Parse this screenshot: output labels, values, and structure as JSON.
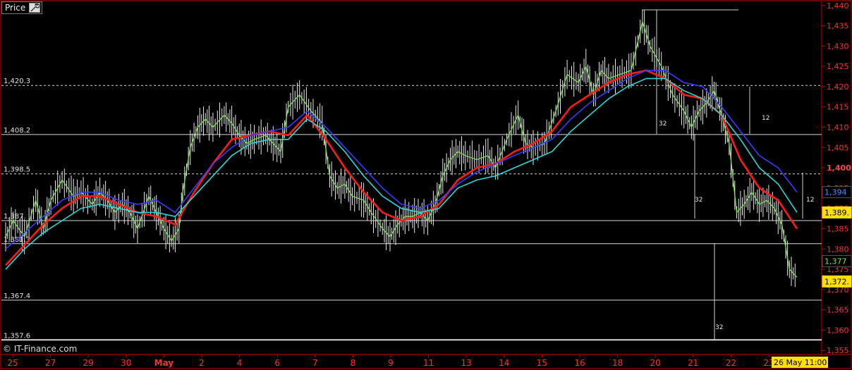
{
  "panel": {
    "tab_label": "Price",
    "tool_icon": "wrench-icon"
  },
  "credit": "© IT-Finance.com",
  "colors": {
    "background": "#000000",
    "frame": "#cc0000",
    "axis_text": "#ff2a2a",
    "ma_green": "#7ee05a",
    "ma_red": "#ff1a1a",
    "ma_blue": "#3a3aff",
    "ma_cyan": "#2bd6d6",
    "price": "#e8e8e8",
    "badge_yellow": "#ffe000"
  },
  "chart_data": {
    "type": "line",
    "title": "",
    "ylim": [
      1354,
      1441
    ],
    "y_ticks": [
      1440,
      1435,
      1430,
      1425,
      1420,
      1415,
      1410,
      1405,
      1400,
      1395,
      1390,
      1385,
      1380,
      1375,
      1370,
      1365,
      1360,
      1355
    ],
    "y_tick_labels": [
      "1,440",
      "1,435",
      "1,430",
      "1,425",
      "1,420",
      "1,415",
      "1,410",
      "1,405",
      "1,400",
      "1,395",
      "1,390",
      "1,385",
      "1,380",
      "1,375",
      "1,370",
      "1,365",
      "1,360",
      "1,355"
    ],
    "x_tick_labels": [
      "25",
      "27",
      "29",
      "30",
      "May",
      "2",
      "4",
      "6",
      "7",
      "8",
      "9",
      "11",
      "13",
      "14",
      "15",
      "16",
      "18",
      "20",
      "21",
      "22",
      "23"
    ],
    "x_tick_positions": [
      0,
      1,
      2,
      3,
      4,
      5,
      6,
      7,
      8,
      9,
      10,
      11,
      12,
      13,
      14,
      15,
      16,
      17,
      18,
      19,
      20
    ],
    "x_last_label": "26 May 11:00",
    "x_len": 21,
    "price": [
      [
        0,
        1383
      ],
      [
        0.2,
        1387
      ],
      [
        0.5,
        1383
      ],
      [
        0.8,
        1392
      ],
      [
        1,
        1385
      ],
      [
        1.2,
        1392
      ],
      [
        1.5,
        1397
      ],
      [
        1.8,
        1393
      ],
      [
        2,
        1394
      ],
      [
        2.3,
        1391
      ],
      [
        2.5,
        1394
      ],
      [
        2.7,
        1392
      ],
      [
        2.9,
        1389
      ],
      [
        3.1,
        1391
      ],
      [
        3.3,
        1389
      ],
      [
        3.5,
        1385
      ],
      [
        3.8,
        1393
      ],
      [
        4,
        1389
      ],
      [
        4.2,
        1385
      ],
      [
        4.4,
        1382
      ],
      [
        4.6,
        1385
      ],
      [
        4.7,
        1394
      ],
      [
        4.9,
        1405
      ],
      [
        5.1,
        1410
      ],
      [
        5.3,
        1412
      ],
      [
        5.5,
        1410
      ],
      [
        5.8,
        1413
      ],
      [
        6,
        1411
      ],
      [
        6.2,
        1408
      ],
      [
        6.4,
        1406
      ],
      [
        6.6,
        1407
      ],
      [
        6.9,
        1408
      ],
      [
        7.1,
        1406
      ],
      [
        7.3,
        1404
      ],
      [
        7.5,
        1415
      ],
      [
        7.8,
        1418
      ],
      [
        8.1,
        1414
      ],
      [
        8.4,
        1411
      ],
      [
        8.6,
        1398
      ],
      [
        8.8,
        1395
      ],
      [
        9.0,
        1396
      ],
      [
        9.2,
        1393
      ],
      [
        9.5,
        1392
      ],
      [
        9.7,
        1389
      ],
      [
        10,
        1385
      ],
      [
        10.2,
        1383
      ],
      [
        10.4,
        1386
      ],
      [
        10.6,
        1388
      ],
      [
        10.8,
        1388
      ],
      [
        11,
        1389
      ],
      [
        11.2,
        1387
      ],
      [
        11.4,
        1391
      ],
      [
        11.6,
        1398
      ],
      [
        11.8,
        1402
      ],
      [
        12,
        1404
      ],
      [
        12.2,
        1403
      ],
      [
        12.5,
        1402
      ],
      [
        12.8,
        1403
      ],
      [
        13,
        1400
      ],
      [
        13.3,
        1407
      ],
      [
        13.6,
        1413
      ],
      [
        13.8,
        1406
      ],
      [
        14.0,
        1405
      ],
      [
        14.3,
        1406
      ],
      [
        14.6,
        1414
      ],
      [
        14.9,
        1423
      ],
      [
        15.2,
        1421
      ],
      [
        15.4,
        1425
      ],
      [
        15.6,
        1418
      ],
      [
        15.8,
        1424
      ],
      [
        16.0,
        1422
      ],
      [
        16.3,
        1423
      ],
      [
        16.6,
        1424
      ],
      [
        16.9,
        1436
      ],
      [
        17.1,
        1430
      ],
      [
        17.4,
        1425
      ],
      [
        17.7,
        1418
      ],
      [
        18.0,
        1414
      ],
      [
        18.2,
        1410
      ],
      [
        18.4,
        1414
      ],
      [
        18.6,
        1416
      ],
      [
        18.8,
        1419
      ],
      [
        19.0,
        1413
      ],
      [
        19.2,
        1406
      ],
      [
        19.4,
        1389
      ],
      [
        19.6,
        1391
      ],
      [
        19.8,
        1394
      ],
      [
        20.0,
        1391
      ],
      [
        20.2,
        1392
      ],
      [
        20.4,
        1390
      ],
      [
        20.6,
        1386
      ],
      [
        20.8,
        1375
      ],
      [
        21.0,
        1373
      ]
    ],
    "series": [
      {
        "color": "#7ee05a",
        "values": [
          [
            0,
            1384
          ],
          [
            0.5,
            1385
          ],
          [
            1,
            1387
          ],
          [
            1.5,
            1393
          ],
          [
            2,
            1394
          ],
          [
            2.5,
            1393
          ],
          [
            3,
            1391
          ],
          [
            3.5,
            1388
          ],
          [
            4,
            1389
          ],
          [
            4.3,
            1385
          ],
          [
            4.6,
            1386
          ],
          [
            4.9,
            1400
          ],
          [
            5.2,
            1408
          ],
          [
            5.5,
            1410
          ],
          [
            6,
            1409
          ],
          [
            6.5,
            1407
          ],
          [
            7,
            1406
          ],
          [
            7.4,
            1410
          ],
          [
            7.8,
            1416
          ],
          [
            8.2,
            1413
          ],
          [
            8.6,
            1400
          ],
          [
            9,
            1395
          ],
          [
            9.5,
            1393
          ],
          [
            10,
            1388
          ],
          [
            10.4,
            1385
          ],
          [
            10.8,
            1388
          ],
          [
            11.2,
            1389
          ],
          [
            11.6,
            1397
          ],
          [
            12,
            1402
          ],
          [
            12.5,
            1402
          ],
          [
            13,
            1401
          ],
          [
            13.4,
            1407
          ],
          [
            13.8,
            1410
          ],
          [
            14.2,
            1406
          ],
          [
            14.6,
            1412
          ],
          [
            15,
            1420
          ],
          [
            15.5,
            1422
          ],
          [
            16,
            1423
          ],
          [
            16.5,
            1424
          ],
          [
            16.8,
            1427
          ],
          [
            17.1,
            1430
          ],
          [
            17.5,
            1424
          ],
          [
            18,
            1414
          ],
          [
            18.5,
            1415
          ],
          [
            18.9,
            1418
          ],
          [
            19.2,
            1410
          ],
          [
            19.4,
            1393
          ],
          [
            19.8,
            1393
          ],
          [
            20.2,
            1391
          ],
          [
            20.6,
            1386
          ],
          [
            20.9,
            1377
          ]
        ]
      },
      {
        "color": "#ff1a1a",
        "values": [
          [
            0,
            1376
          ],
          [
            0.5,
            1381
          ],
          [
            1,
            1386
          ],
          [
            1.5,
            1390
          ],
          [
            2,
            1393
          ],
          [
            2.5,
            1393
          ],
          [
            3,
            1391
          ],
          [
            3.5,
            1389
          ],
          [
            4,
            1388
          ],
          [
            4.5,
            1386
          ],
          [
            5,
            1394
          ],
          [
            5.5,
            1401
          ],
          [
            6,
            1407
          ],
          [
            6.5,
            1408
          ],
          [
            7,
            1409
          ],
          [
            7.5,
            1408
          ],
          [
            8,
            1413
          ],
          [
            8.5,
            1407
          ],
          [
            9,
            1400
          ],
          [
            9.5,
            1394
          ],
          [
            10,
            1389
          ],
          [
            10.5,
            1387
          ],
          [
            11,
            1388
          ],
          [
            11.5,
            1391
          ],
          [
            12,
            1397
          ],
          [
            12.5,
            1400
          ],
          [
            13,
            1401
          ],
          [
            13.5,
            1404
          ],
          [
            14,
            1406
          ],
          [
            14.5,
            1409
          ],
          [
            15,
            1415
          ],
          [
            15.5,
            1418
          ],
          [
            16,
            1421
          ],
          [
            16.5,
            1423
          ],
          [
            17,
            1424
          ],
          [
            17.5,
            1422
          ],
          [
            18,
            1418
          ],
          [
            18.5,
            1417
          ],
          [
            19,
            1413
          ],
          [
            19.5,
            1402
          ],
          [
            20,
            1395
          ],
          [
            20.5,
            1392
          ],
          [
            21,
            1385
          ]
        ]
      },
      {
        "color": "#3a3aff",
        "values": [
          [
            0,
            1380
          ],
          [
            0.5,
            1384
          ],
          [
            1,
            1388
          ],
          [
            1.5,
            1392
          ],
          [
            2,
            1394
          ],
          [
            2.5,
            1394
          ],
          [
            3,
            1392
          ],
          [
            3.5,
            1391
          ],
          [
            4,
            1392
          ],
          [
            4.5,
            1389
          ],
          [
            5,
            1395
          ],
          [
            5.5,
            1401
          ],
          [
            6,
            1405
          ],
          [
            6.5,
            1408
          ],
          [
            7,
            1409
          ],
          [
            7.5,
            1410
          ],
          [
            8,
            1414
          ],
          [
            8.5,
            1410
          ],
          [
            9,
            1405
          ],
          [
            9.5,
            1400
          ],
          [
            10,
            1395
          ],
          [
            10.5,
            1391
          ],
          [
            11,
            1390
          ],
          [
            11.5,
            1392
          ],
          [
            12,
            1396
          ],
          [
            12.5,
            1399
          ],
          [
            13,
            1401
          ],
          [
            13.5,
            1403
          ],
          [
            14,
            1405
          ],
          [
            14.5,
            1407
          ],
          [
            15,
            1412
          ],
          [
            15.5,
            1416
          ],
          [
            16,
            1419
          ],
          [
            16.5,
            1422
          ],
          [
            17,
            1424
          ],
          [
            17.5,
            1424
          ],
          [
            18,
            1421
          ],
          [
            18.5,
            1420
          ],
          [
            19,
            1415
          ],
          [
            19.5,
            1409
          ],
          [
            20,
            1403
          ],
          [
            20.5,
            1400
          ],
          [
            21,
            1394
          ]
        ]
      },
      {
        "color": "#2bd6d6",
        "values": [
          [
            0,
            1375
          ],
          [
            0.5,
            1380
          ],
          [
            1,
            1384
          ],
          [
            1.5,
            1387
          ],
          [
            2,
            1390
          ],
          [
            2.5,
            1391
          ],
          [
            3,
            1390
          ],
          [
            3.5,
            1389
          ],
          [
            4,
            1389
          ],
          [
            4.5,
            1388
          ],
          [
            5,
            1393
          ],
          [
            5.5,
            1398
          ],
          [
            6,
            1403
          ],
          [
            6.5,
            1406
          ],
          [
            7,
            1407
          ],
          [
            7.5,
            1407
          ],
          [
            8,
            1412
          ],
          [
            8.5,
            1409
          ],
          [
            9,
            1404
          ],
          [
            9.5,
            1398
          ],
          [
            10,
            1393
          ],
          [
            10.5,
            1390
          ],
          [
            11,
            1389
          ],
          [
            11.5,
            1390
          ],
          [
            12,
            1395
          ],
          [
            12.5,
            1397
          ],
          [
            13,
            1398
          ],
          [
            13.5,
            1400
          ],
          [
            14,
            1402
          ],
          [
            14.5,
            1404
          ],
          [
            15,
            1409
          ],
          [
            15.5,
            1413
          ],
          [
            16,
            1417
          ],
          [
            16.5,
            1420
          ],
          [
            17,
            1422
          ],
          [
            17.5,
            1422
          ],
          [
            18,
            1419
          ],
          [
            18.5,
            1417
          ],
          [
            19,
            1413
          ],
          [
            19.5,
            1407
          ],
          [
            20,
            1400
          ],
          [
            20.5,
            1396
          ],
          [
            21,
            1389
          ]
        ]
      }
    ],
    "h_levels": [
      {
        "value": 1420.3,
        "label": "1,420.3",
        "style": "dashed"
      },
      {
        "value": 1408.2,
        "label": "1,408.2",
        "style": "solid"
      },
      {
        "value": 1398.5,
        "label": "1,398.5",
        "style": "dashed"
      },
      {
        "value": 1387,
        "label": "1,387.",
        "style": "solid"
      },
      {
        "value": 1381.3,
        "label": "1,381.3",
        "style": "solid"
      },
      {
        "value": 1367.4,
        "label": "1,367.4",
        "style": "solid"
      },
      {
        "value": 1357.6,
        "label": "1,357.6",
        "style": "solid"
      }
    ],
    "annotations": [
      "32",
      "32",
      "32",
      "12",
      "12"
    ],
    "badges": [
      {
        "value": 1394,
        "label": "1,394",
        "bg": "#000000",
        "fg": "#4a8cff"
      },
      {
        "value": 1389,
        "label": "1,389.",
        "bg": "#ffe000",
        "fg": "#000000"
      },
      {
        "value": 1377,
        "label": "1,377",
        "bg": "#000000",
        "fg": "#7ee05a"
      },
      {
        "value": 1372,
        "label": "1,372.",
        "bg": "#ffe000",
        "fg": "#000000"
      }
    ]
  }
}
